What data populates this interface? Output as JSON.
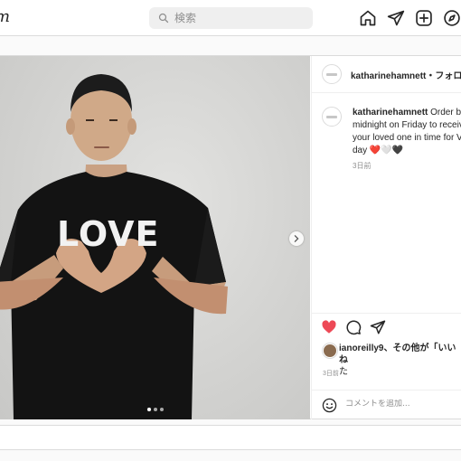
{
  "topbar": {
    "logo_text": "m",
    "search_placeholder": "検索",
    "nav_icons": [
      "home-icon",
      "direct-message-icon",
      "new-post-icon",
      "explore-icon"
    ]
  },
  "post": {
    "username": "katharinehamnett",
    "separator": "・",
    "follow_label": "フォロー",
    "shirt_text": "LOVE",
    "caption": {
      "username": "katharinehamnett",
      "lines": [
        " Order be",
        "midnight on Friday to receiv",
        "your loved one in time for Va",
        "day ❤️🤍🖤"
      ],
      "time": "3日前"
    },
    "carousel": {
      "count": 3,
      "active": 0
    },
    "likes": {
      "user": "ianoreilly9",
      "line1_suffix": "、その他が「いいね",
      "line2": "た",
      "time": "3日前"
    },
    "comment_placeholder": "コメントを追加...",
    "liked": true,
    "colors": {
      "like_red": "#ed4956",
      "border": "#dbdbdb",
      "muted": "#8e8e8e"
    }
  }
}
